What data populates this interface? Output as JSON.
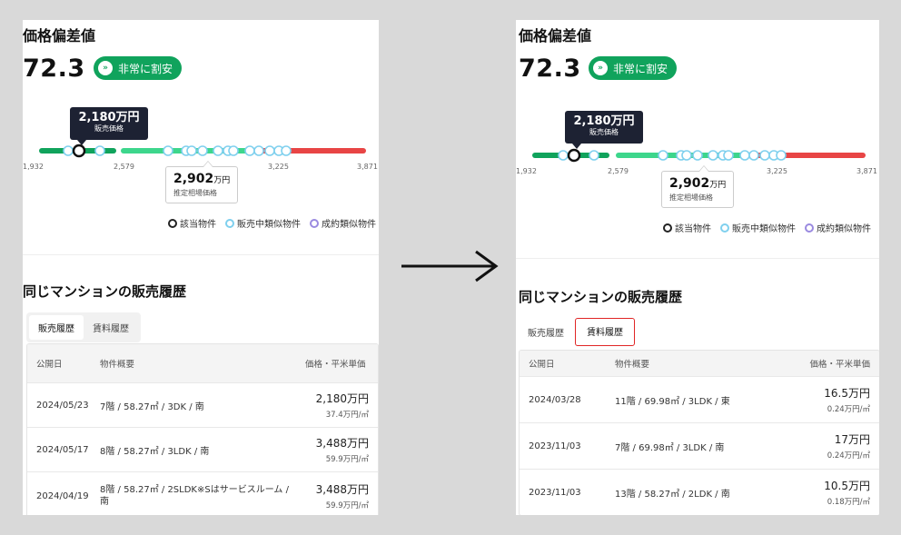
{
  "left": {
    "title": "価格偏差値",
    "score": "72.3",
    "badge": "非常に割安",
    "badge_icon": "double-chevron-down-icon",
    "tooltip_price": "2,180万円",
    "tooltip_label": "販売価格",
    "ticks": [
      "1,932",
      "2,579",
      "3,225",
      "3,871"
    ],
    "estimate_value": "2,902",
    "estimate_unit": "万円",
    "estimate_label": "推定相場価格",
    "legend": [
      "該当物件",
      "販売中類似物件",
      "成約類似物件"
    ],
    "section_title": "同じマンションの販売履歴",
    "tabs": [
      "販売履歴",
      "賃料履歴"
    ],
    "active_tab": 0,
    "table": {
      "headers": [
        "公開日",
        "物件概要",
        "価格・平米単価"
      ],
      "rows": [
        {
          "date": "2024/05/23",
          "summary": "7階 / 58.27㎡ / 3DK / 南",
          "price": "2,180万円",
          "unit": "37.4万円/㎡"
        },
        {
          "date": "2024/05/17",
          "summary": "8階 / 58.27㎡ / 3LDK / 南",
          "price": "3,488万円",
          "unit": "59.9万円/㎡"
        },
        {
          "date": "2024/04/19",
          "summary": "8階 / 58.27㎡ / 2SLDK※Sはサービスルーム / 南",
          "price": "3,488万円",
          "unit": "59.9万円/㎡"
        }
      ]
    }
  },
  "right": {
    "title": "価格偏差値",
    "score": "72.3",
    "badge": "非常に割安",
    "badge_icon": "double-chevron-down-icon",
    "tooltip_price": "2,180万円",
    "tooltip_label": "販売価格",
    "ticks": [
      "1,932",
      "2,579",
      "3,225",
      "3,871"
    ],
    "estimate_value": "2,902",
    "estimate_unit": "万円",
    "estimate_label": "推定相場価格",
    "legend": [
      "該当物件",
      "販売中類似物件",
      "成約類似物件"
    ],
    "section_title": "同じマンションの販売履歴",
    "tabs": [
      "販売履歴",
      "賃料履歴"
    ],
    "active_tab": 1,
    "table": {
      "headers": [
        "公開日",
        "物件概要",
        "価格・平米単価"
      ],
      "rows": [
        {
          "date": "2024/03/28",
          "summary": "11階 / 69.98㎡ / 3LDK / 東",
          "price": "16.5万円",
          "unit": "0.24万円/㎡"
        },
        {
          "date": "2023/11/03",
          "summary": "7階 / 69.98㎡ / 3LDK / 南",
          "price": "17万円",
          "unit": "0.24万円/㎡"
        },
        {
          "date": "2023/11/03",
          "summary": "13階 / 58.27㎡ / 2LDK / 南",
          "price": "10.5万円",
          "unit": "0.18万円/㎡"
        }
      ]
    }
  },
  "colors": {
    "green": "#10a35c",
    "light_green": "#3dd68c",
    "red": "#e84545",
    "tooltip_bg": "#1d2233",
    "highlight_outline": "#e02525"
  },
  "transition_icon": "right-arrow-icon"
}
